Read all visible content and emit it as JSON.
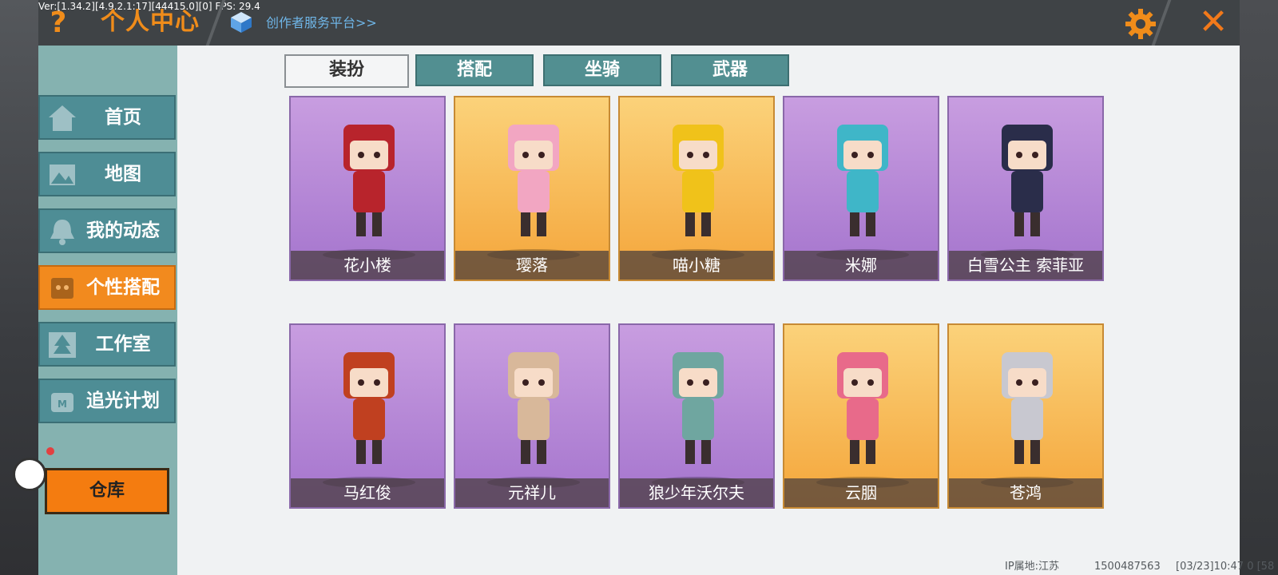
{
  "debug_text": "Ver:[1.34.2][4.9.2.1:17][44415.0][0] FPS: 29.4",
  "header": {
    "help_glyph": "?",
    "title": "个人中心",
    "creator_link": "创作者服务平台>>",
    "close_glyph": "✕"
  },
  "sidebar": {
    "items": [
      {
        "label": "首页",
        "icon": "home-icon",
        "active": false
      },
      {
        "label": "地图",
        "icon": "map-icon",
        "active": false
      },
      {
        "label": "我的动态",
        "icon": "bell-icon",
        "active": false
      },
      {
        "label": "个性搭配",
        "icon": "avatar-icon",
        "active": true
      },
      {
        "label": "工作室",
        "icon": "tree-icon",
        "active": false
      },
      {
        "label": "追光计划",
        "icon": "spotlight-icon",
        "active": false
      }
    ],
    "warehouse_label": "仓库"
  },
  "tabs": [
    {
      "label": "装扮",
      "active": true
    },
    {
      "label": "搭配",
      "active": false
    },
    {
      "label": "坐骑",
      "active": false
    },
    {
      "label": "武器",
      "active": false
    }
  ],
  "skins": [
    {
      "name": "花小楼",
      "bg": "purple",
      "color": "#b8242c"
    },
    {
      "name": "璎落",
      "bg": "gold",
      "color": "#f2a6c2"
    },
    {
      "name": "喵小糖",
      "bg": "gold",
      "color": "#f0c21a"
    },
    {
      "name": "米娜",
      "bg": "purple",
      "color": "#3fb6c8"
    },
    {
      "name": "白雪公主 索菲亚",
      "bg": "purple",
      "color": "#2a2d4a"
    },
    {
      "name": "马红俊",
      "bg": "purple",
      "color": "#c04020"
    },
    {
      "name": "元祥儿",
      "bg": "purple",
      "color": "#d8b89a"
    },
    {
      "name": "狼少年沃尔夫",
      "bg": "purple",
      "color": "#6fa6a0"
    },
    {
      "name": "云胭",
      "bg": "gold",
      "color": "#e86a8a"
    },
    {
      "name": "苍鸿",
      "bg": "gold",
      "color": "#c8c8d0"
    }
  ],
  "footer": {
    "ip_location": "IP属地:江苏",
    "user_id": "1500487563",
    "timestamp": "[03/23]10:47 0 [58"
  },
  "colors": {
    "accent_orange": "#f08c1a",
    "tab_teal": "#528f91",
    "link_blue": "#6fb6e8"
  }
}
